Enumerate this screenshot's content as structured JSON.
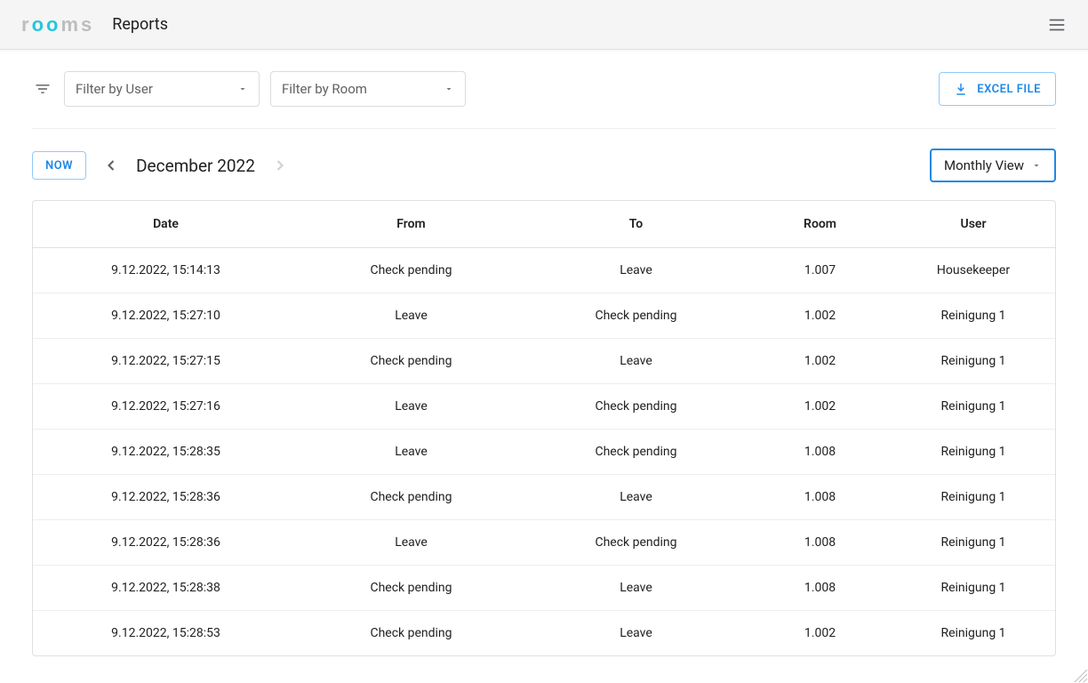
{
  "appbar": {
    "logo_prefix": "r",
    "logo_mid": "oo",
    "logo_suffix": "ms",
    "title": "Reports"
  },
  "filters": {
    "user_placeholder": "Filter by User",
    "room_placeholder": "Filter by Room"
  },
  "buttons": {
    "excel": "EXCEL FILE",
    "now": "NOW",
    "view": "Monthly View"
  },
  "calendar": {
    "label": "December 2022"
  },
  "table": {
    "headers": {
      "date": "Date",
      "from": "From",
      "to": "To",
      "room": "Room",
      "user": "User"
    },
    "rows": [
      {
        "date": "9.12.2022, 15:14:13",
        "from": "Check pending",
        "to": "Leave",
        "room": "1.007",
        "user": "Housekeeper"
      },
      {
        "date": "9.12.2022, 15:27:10",
        "from": "Leave",
        "to": "Check pending",
        "room": "1.002",
        "user": "Reinigung 1"
      },
      {
        "date": "9.12.2022, 15:27:15",
        "from": "Check pending",
        "to": "Leave",
        "room": "1.002",
        "user": "Reinigung 1"
      },
      {
        "date": "9.12.2022, 15:27:16",
        "from": "Leave",
        "to": "Check pending",
        "room": "1.002",
        "user": "Reinigung 1"
      },
      {
        "date": "9.12.2022, 15:28:35",
        "from": "Leave",
        "to": "Check pending",
        "room": "1.008",
        "user": "Reinigung 1"
      },
      {
        "date": "9.12.2022, 15:28:36",
        "from": "Check pending",
        "to": "Leave",
        "room": "1.008",
        "user": "Reinigung 1"
      },
      {
        "date": "9.12.2022, 15:28:36",
        "from": "Leave",
        "to": "Check pending",
        "room": "1.008",
        "user": "Reinigung 1"
      },
      {
        "date": "9.12.2022, 15:28:38",
        "from": "Check pending",
        "to": "Leave",
        "room": "1.008",
        "user": "Reinigung 1"
      },
      {
        "date": "9.12.2022, 15:28:53",
        "from": "Check pending",
        "to": "Leave",
        "room": "1.002",
        "user": "Reinigung 1"
      }
    ]
  }
}
